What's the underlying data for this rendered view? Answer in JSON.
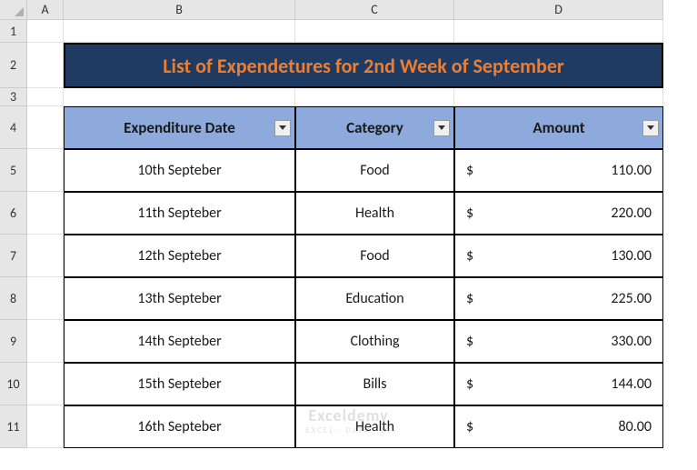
{
  "columns": [
    "A",
    "B",
    "C",
    "D"
  ],
  "rows": [
    "1",
    "2",
    "3",
    "4",
    "5",
    "6",
    "7",
    "8",
    "9",
    "10",
    "11"
  ],
  "title": "List of Expendetures for 2nd  Week of September",
  "headers": {
    "date": "Expenditure Date",
    "category": "Category",
    "amount": "Amount"
  },
  "currency": "$",
  "data": [
    {
      "date": "10th Septeber",
      "category": "Food",
      "amount": "110.00"
    },
    {
      "date": "11th Septeber",
      "category": "Health",
      "amount": "220.00"
    },
    {
      "date": "12th Septeber",
      "category": "Food",
      "amount": "130.00"
    },
    {
      "date": "13th Septeber",
      "category": "Education",
      "amount": "225.00"
    },
    {
      "date": "14th Septeber",
      "category": "Clothing",
      "amount": "330.00"
    },
    {
      "date": "15th Septeber",
      "category": "Bills",
      "amount": "144.00"
    },
    {
      "date": "16th Septeber",
      "category": "Health",
      "amount": "80.00"
    }
  ],
  "watermark": {
    "main": "Exceldemy",
    "sub": "EXCEL · DATA · BI"
  },
  "chart_data": {
    "type": "table",
    "title": "List of Expendetures for 2nd  Week of September",
    "columns": [
      "Expenditure Date",
      "Category",
      "Amount"
    ],
    "rows": [
      [
        "10th Septeber",
        "Food",
        110.0
      ],
      [
        "11th Septeber",
        "Health",
        220.0
      ],
      [
        "12th Septeber",
        "Food",
        130.0
      ],
      [
        "13th Septeber",
        "Education",
        225.0
      ],
      [
        "14th Septeber",
        "Clothing",
        330.0
      ],
      [
        "15th Septeber",
        "Bills",
        144.0
      ],
      [
        "16th Septeber",
        "Health",
        80.0
      ]
    ]
  }
}
